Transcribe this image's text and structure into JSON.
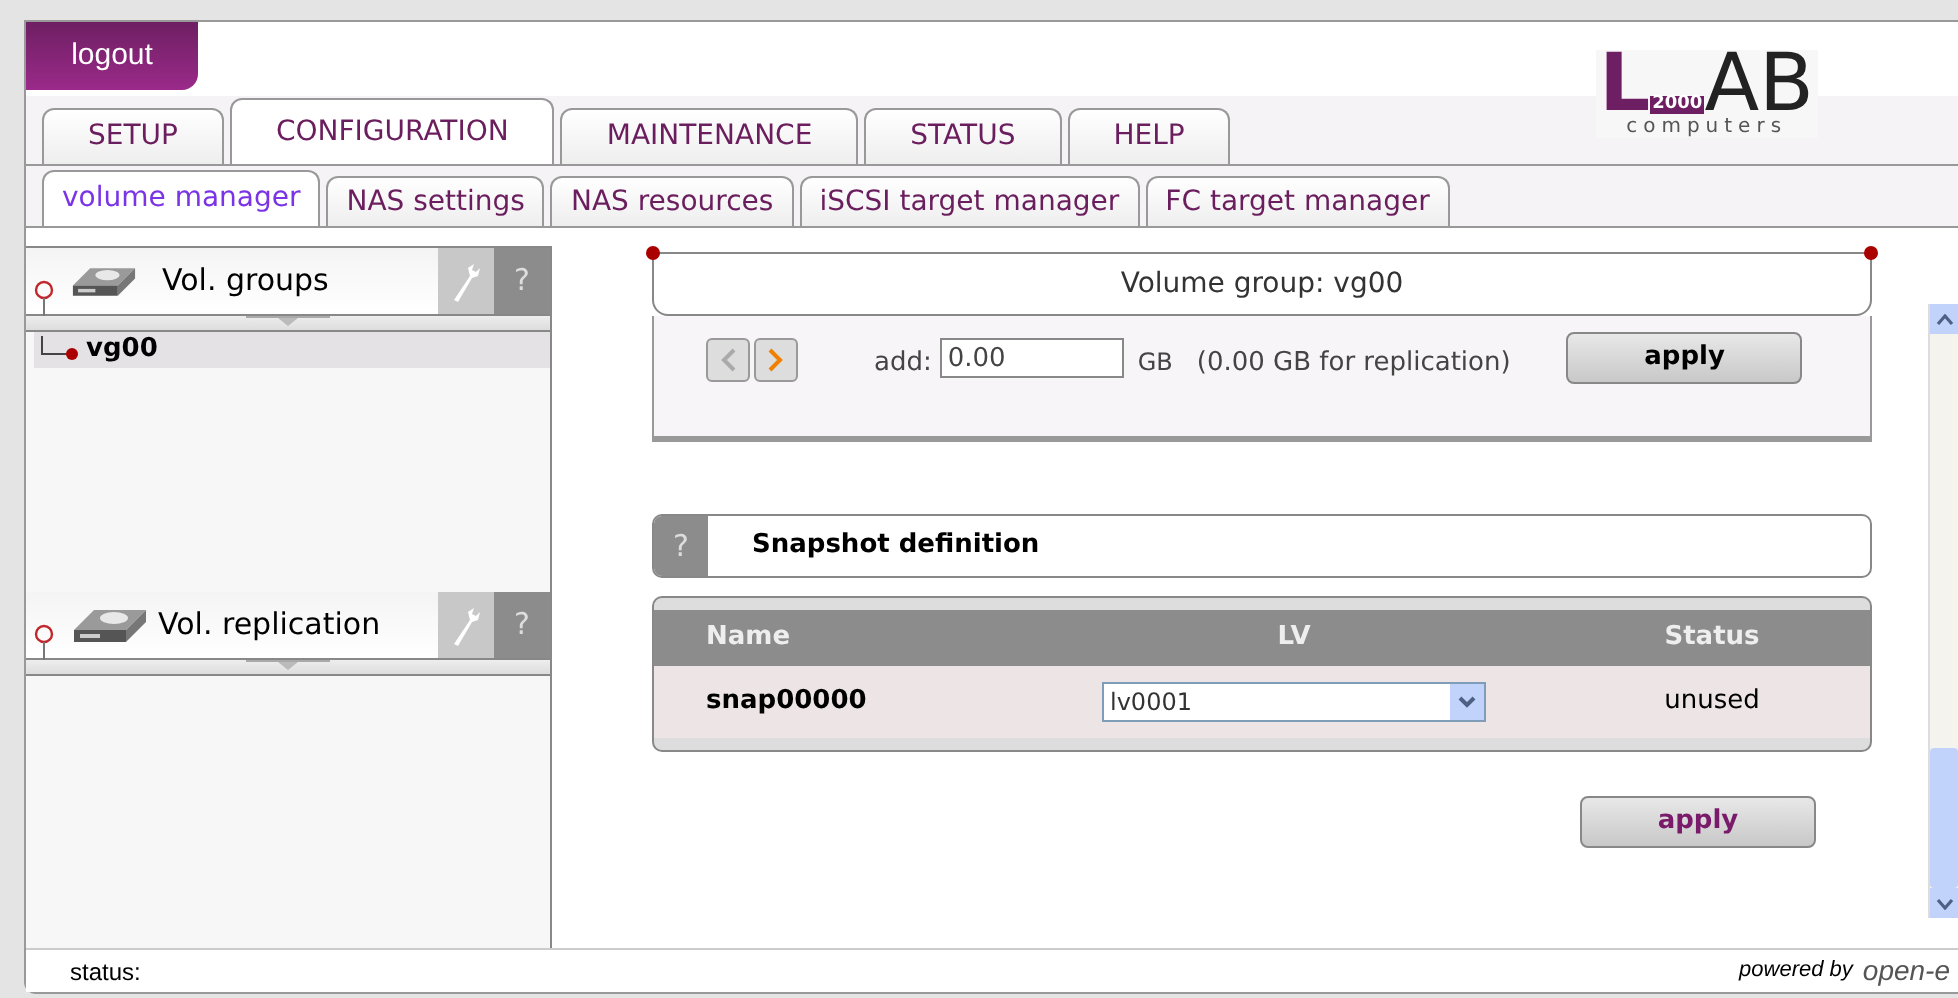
{
  "logout": "logout",
  "logo": {
    "first_letter": "L",
    "rest": "AB",
    "year": "2000",
    "tagline": "computers"
  },
  "tabs": [
    {
      "label": "SETUP",
      "selected": false
    },
    {
      "label": "CONFIGURATION",
      "selected": true
    },
    {
      "label": "MAINTENANCE",
      "selected": false
    },
    {
      "label": "STATUS",
      "selected": false
    },
    {
      "label": "HELP",
      "selected": false
    }
  ],
  "subtabs": [
    {
      "label": "volume manager",
      "selected": true
    },
    {
      "label": "NAS settings",
      "selected": false
    },
    {
      "label": "NAS resources",
      "selected": false
    },
    {
      "label": "iSCSI target manager",
      "selected": false
    },
    {
      "label": "FC target manager",
      "selected": false
    }
  ],
  "sidebar": [
    {
      "title": "Vol. groups",
      "help": "?",
      "items": [
        {
          "label": "vg00",
          "selected": true
        }
      ]
    },
    {
      "title": "Vol. replication",
      "help": "?"
    }
  ],
  "volume_group": {
    "title": "Volume group: vg00",
    "prev_disabled": true,
    "next_disabled": false,
    "add_label": "add:",
    "add_value": "0.00",
    "unit": "GB",
    "note": "(0.00 GB for replication)",
    "apply": "apply"
  },
  "snapshot": {
    "help": "?",
    "title": "Snapshot definition",
    "columns": [
      "Name",
      "LV",
      "Status"
    ],
    "rows": [
      {
        "name": "snap00000",
        "lv": "lv0001",
        "status": "unused"
      }
    ],
    "apply": "apply"
  },
  "status_bar": {
    "label": "status:",
    "powered_by": "powered by",
    "brand": "open-e"
  }
}
